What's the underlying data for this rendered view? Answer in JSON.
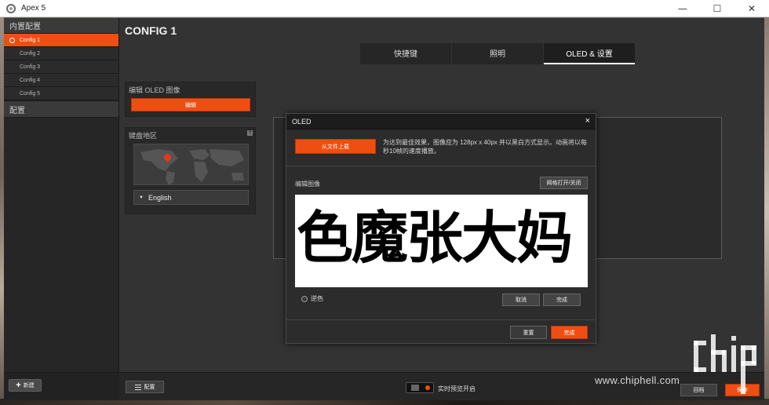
{
  "window": {
    "title": "Apex 5",
    "minimize": "—",
    "maximize": "☐",
    "close": "✕"
  },
  "sidebar": {
    "section1": "内置配置",
    "configs": [
      "Config 1",
      "Config 2",
      "Config 3",
      "Config 4",
      "Config 5"
    ],
    "active_index": 0,
    "section2": "配置",
    "new_button": "新建"
  },
  "main": {
    "title": "CONFIG 1",
    "tabs": [
      {
        "label": "快捷键",
        "active": false
      },
      {
        "label": "照明",
        "active": false
      },
      {
        "label": "OLED & 设置",
        "active": true
      }
    ],
    "oled_panel": {
      "label": "编辑 OLED 图像",
      "edit_button": "编辑"
    },
    "region_panel": {
      "label": "键盘地区",
      "help": "?",
      "language": "English"
    }
  },
  "dialog": {
    "title": "OLED",
    "close": "×",
    "upload_button": "从文件上载",
    "note": "为达到最佳效果，图像应为 128px x 40px 并以黑白方式显示。动画将以每秒10帧的速度播放。",
    "edit_label": "编辑图像",
    "grid_toggle": "网格打开/关闭",
    "canvas_text": "色魔张大妈",
    "invert_label": "逆色",
    "cancel_button": "取消",
    "done_inner_button": "完成",
    "reset_button": "重置",
    "done_button": "完成"
  },
  "bottombar": {
    "config_button": "配置",
    "live_preview": "实时预览开启",
    "restore_button": "回档",
    "save_button": "保存"
  },
  "watermark": "www.chiphell.com",
  "colors": {
    "accent": "#ef4e12",
    "bg": "#333333",
    "panel": "#282828"
  }
}
